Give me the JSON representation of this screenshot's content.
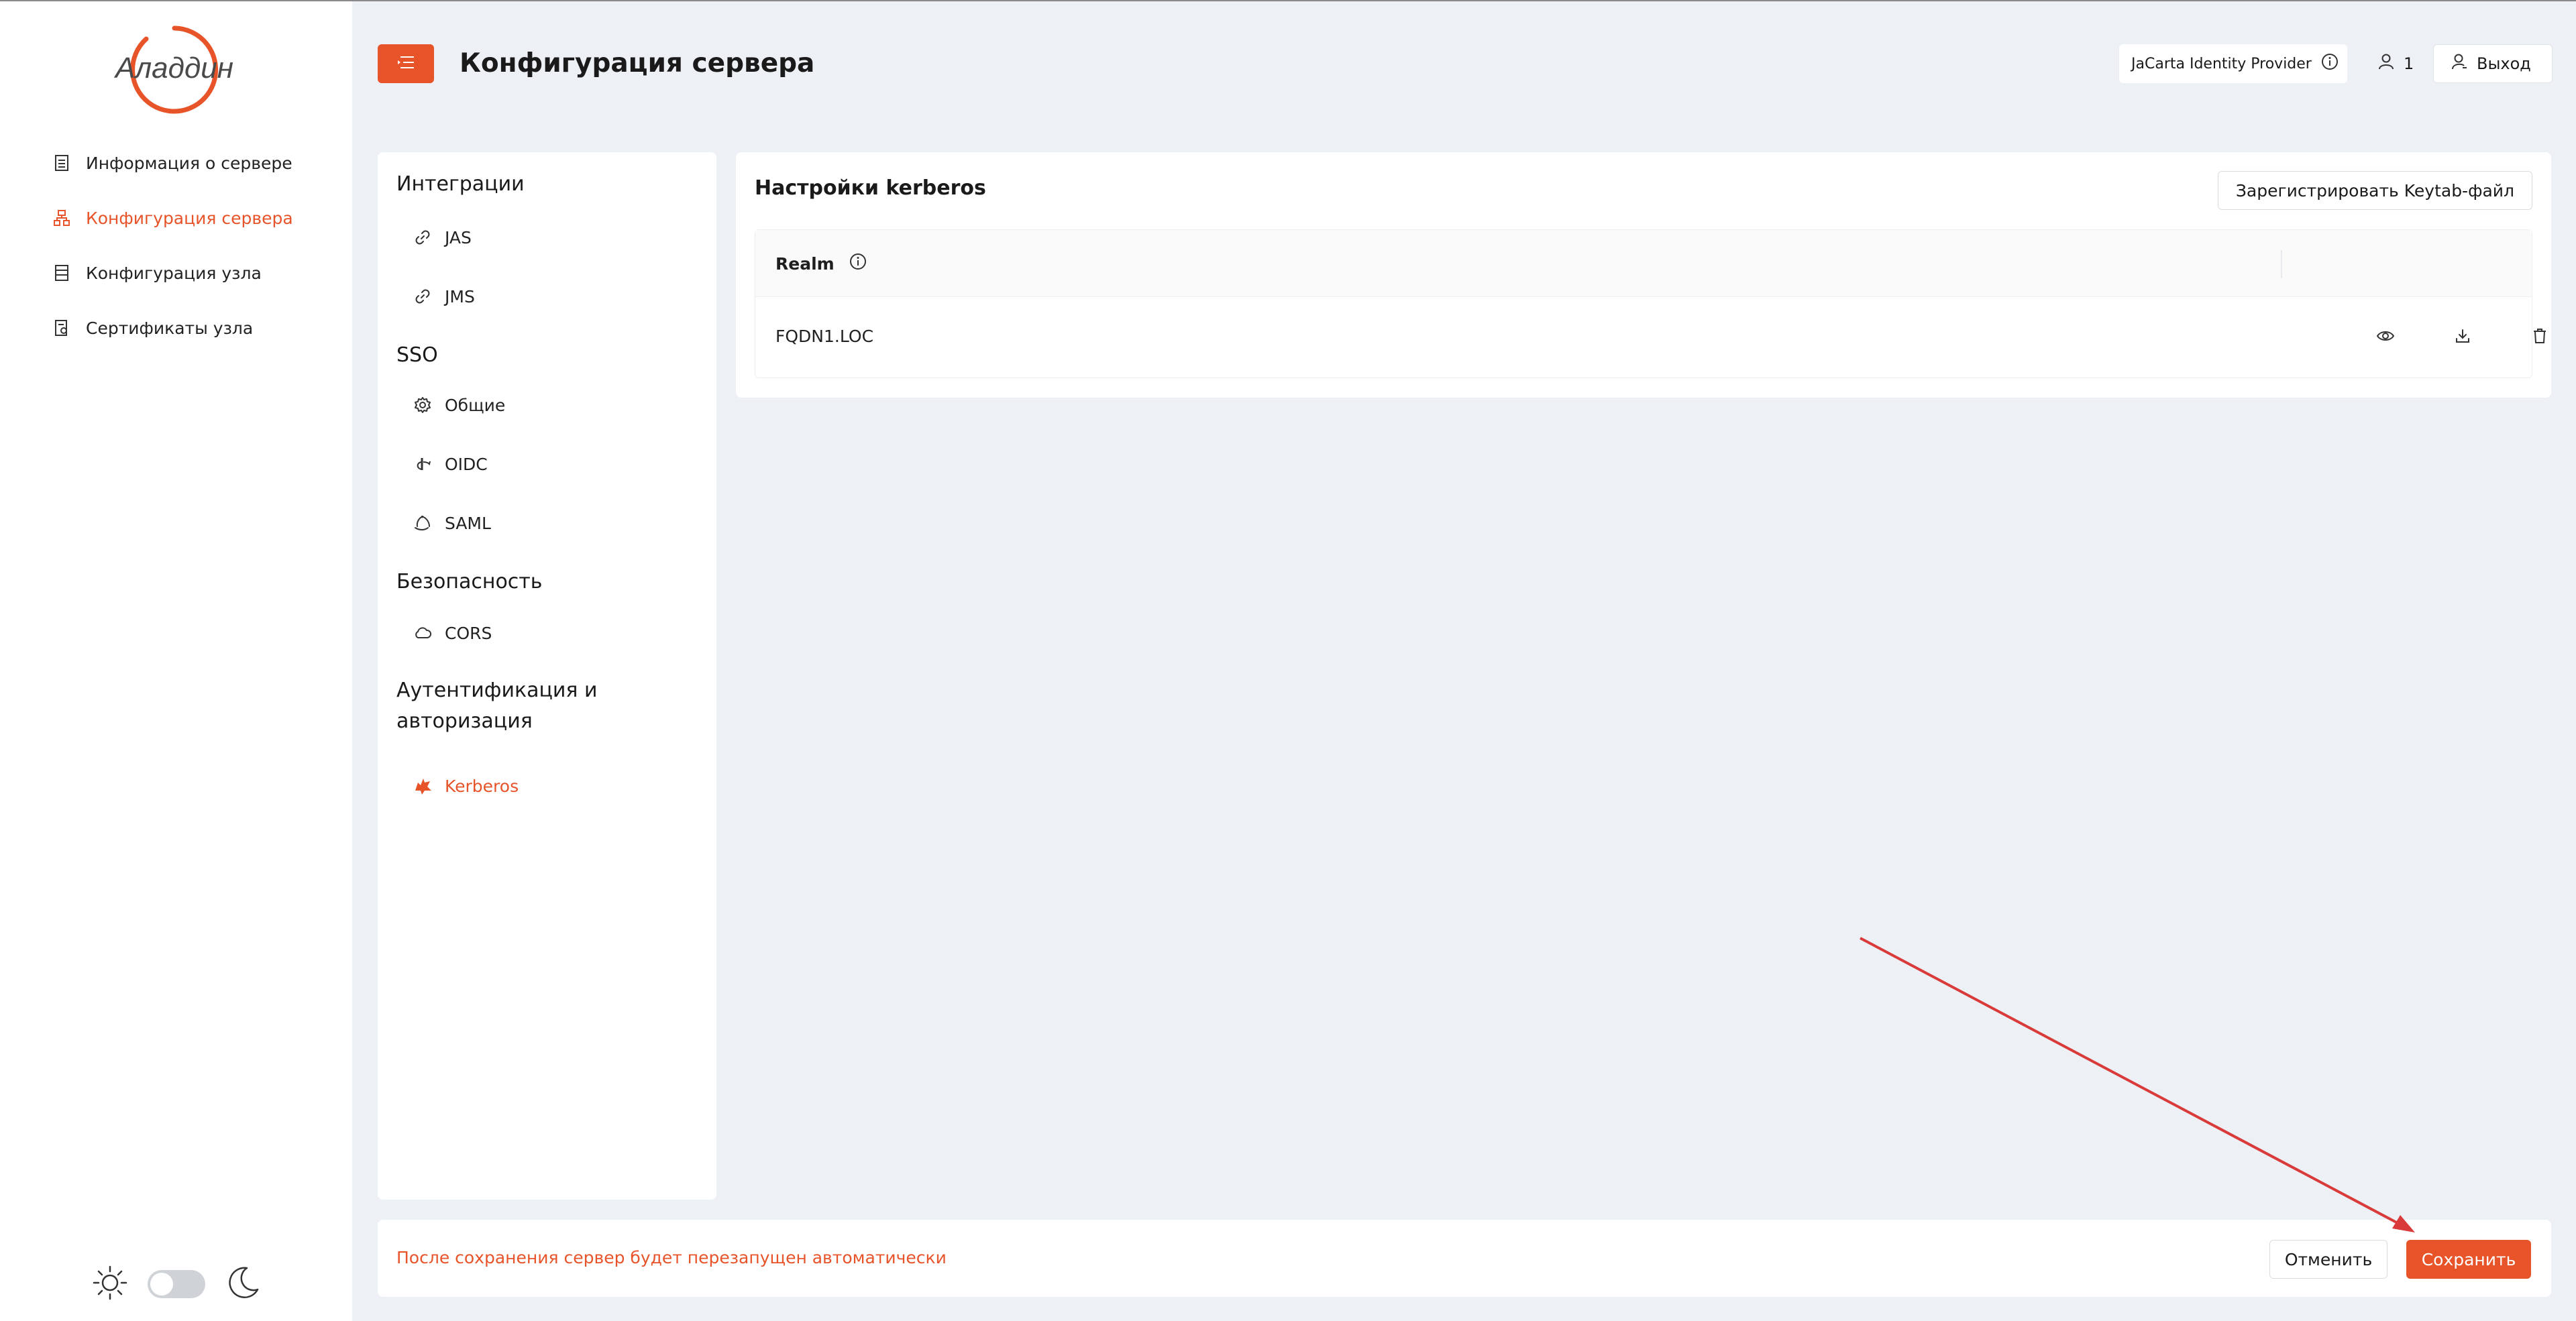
{
  "brand": {
    "logo_text": "Аладдин",
    "accent": "#e8542a"
  },
  "sidebar": {
    "items": [
      {
        "label": "Информация о сервере",
        "icon": "server-info-icon",
        "active": false
      },
      {
        "label": "Конфигурация сервера",
        "icon": "server-config-icon",
        "active": true
      },
      {
        "label": "Конфигурация узла",
        "icon": "node-config-icon",
        "active": false
      },
      {
        "label": "Сертификаты узла",
        "icon": "certificate-icon",
        "active": false
      }
    ],
    "theme": {
      "light_icon": "sun-icon",
      "dark_icon": "moon-icon"
    }
  },
  "header": {
    "title": "Конфигурация сервера",
    "idp_label": "JaCarta Identity Provider",
    "user_count": "1",
    "logout_label": "Выход"
  },
  "settings_menu": {
    "sections": [
      {
        "title": "Интеграции",
        "items": [
          {
            "label": "JAS",
            "icon": "link-icon"
          },
          {
            "label": "JMS",
            "icon": "link-icon"
          }
        ]
      },
      {
        "title": "SSO",
        "items": [
          {
            "label": "Общие",
            "icon": "gear-icon"
          },
          {
            "label": "OIDC",
            "icon": "openid-icon"
          },
          {
            "label": "SAML",
            "icon": "saml-icon"
          }
        ]
      },
      {
        "title": "Безопасность",
        "items": [
          {
            "label": "CORS",
            "icon": "cloud-icon"
          }
        ]
      },
      {
        "title": "Аутентификация и авторизация",
        "items": [
          {
            "label": "Kerberos",
            "icon": "kerberos-icon",
            "active": true
          }
        ]
      }
    ]
  },
  "kerberos": {
    "title": "Настройки kerberos",
    "register_button": "Зарегистрировать Keytab-файл",
    "table": {
      "columns": [
        "Realm"
      ],
      "rows": [
        {
          "realm": "FQDN1.LOC",
          "actions": [
            "eye-icon",
            "download-icon",
            "trash-icon"
          ]
        }
      ]
    }
  },
  "footer": {
    "message": "После сохранения сервер будет перезапущен автоматически",
    "cancel_label": "Отменить",
    "save_label": "Сохранить"
  }
}
